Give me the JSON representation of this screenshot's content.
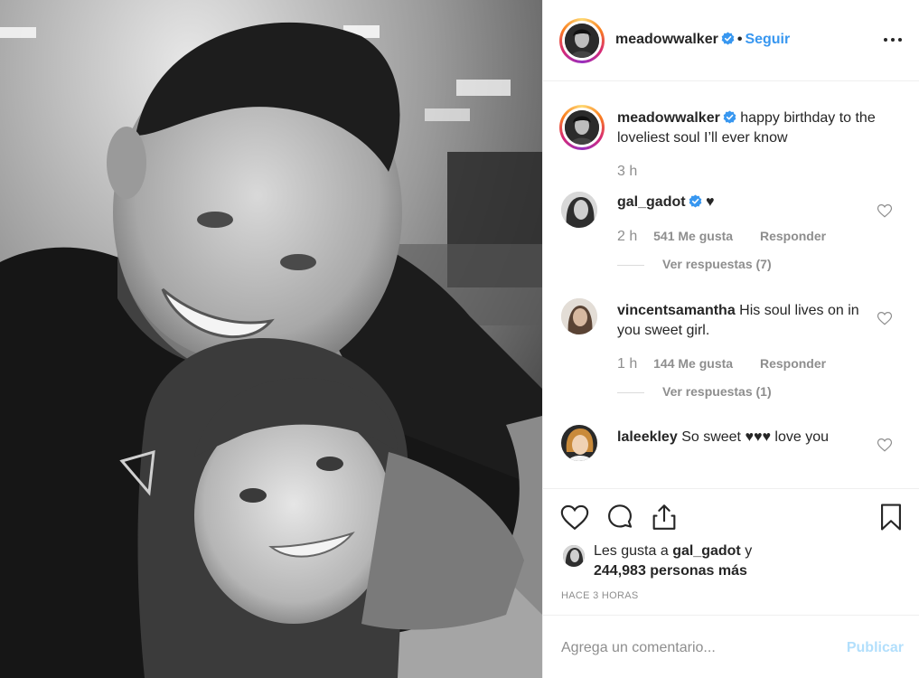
{
  "header": {
    "username": "meadowwalker",
    "separator": "•",
    "follow_label": "Seguir"
  },
  "caption": {
    "username": "meadowwalker",
    "text": "happy birthday to the loveliest soul I’ll ever know",
    "time": "3 h"
  },
  "comments": [
    {
      "username": "gal_gadot",
      "text": "♥",
      "time": "2 h",
      "likes": "541 Me gusta",
      "reply": "Responder",
      "view_replies": "Ver respuestas (7)"
    },
    {
      "username": "vincentsamantha",
      "text": "His soul lives on in you sweet girl.",
      "time": "1 h",
      "likes": "144 Me gusta",
      "reply": "Responder",
      "view_replies": "Ver respuestas (1)"
    },
    {
      "username": "laleekley",
      "text": "So sweet ♥♥♥ love you"
    }
  ],
  "likes": {
    "prefix": "Les gusta a",
    "user": "gal_gadot",
    "connector": "y",
    "count": "244,983 personas más"
  },
  "posted_ago": "HACE 3 HORAS",
  "comment_box": {
    "placeholder": "Agrega un comentario...",
    "publish_label": "Publicar"
  },
  "colors": {
    "link_blue": "#3897f0",
    "verified_blue": "#3897f0",
    "muted_text": "#8e8e8e",
    "publish_disabled": "#b2dffc"
  },
  "icons": [
    "verified-badge-icon",
    "more-options-icon",
    "heart-icon",
    "comment-icon",
    "share-icon",
    "bookmark-icon"
  ]
}
